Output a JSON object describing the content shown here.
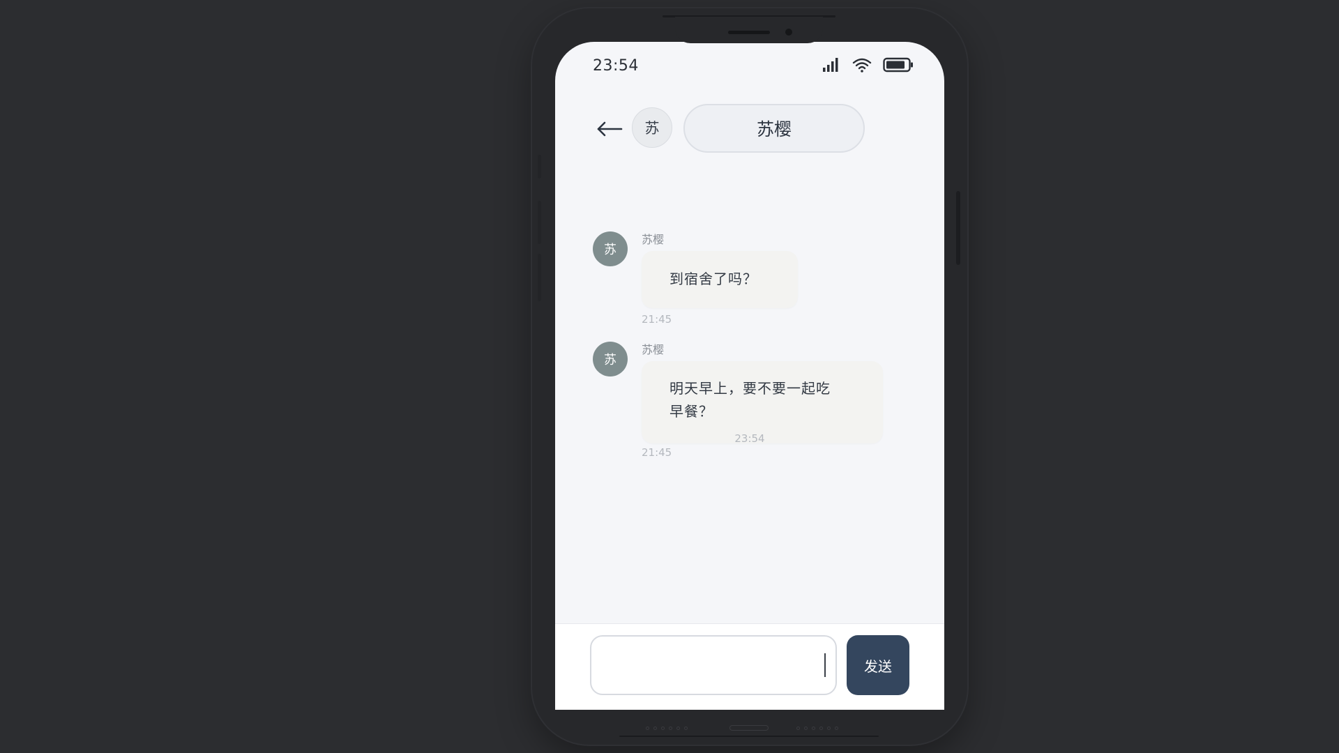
{
  "status_bar": {
    "time": "23:54",
    "icons": [
      "signal-icon",
      "wifi-icon",
      "battery-icon"
    ]
  },
  "chat_header": {
    "back_icon": "arrow-left-icon",
    "avatar_initial": "苏",
    "contact_name": "苏樱"
  },
  "messages": [
    {
      "avatar_initial": "苏",
      "sender": "苏樱",
      "text_lines": [
        "到宿舍了吗？"
      ],
      "time": "21:45"
    },
    {
      "avatar_initial": "苏",
      "sender": "苏樱",
      "text_lines": [
        "明天早上，要不要一起吃",
        "早餐？"
      ],
      "time": "21:45"
    }
  ],
  "current_time_marker": "23:54",
  "composer": {
    "input_value": "",
    "send_label": "发送"
  },
  "colors": {
    "background": "#2c2d30",
    "screen": "#f5f6f9",
    "avatar": "#7f8d8e",
    "send_button": "#34465e",
    "bubble": "#f3f3f1"
  }
}
